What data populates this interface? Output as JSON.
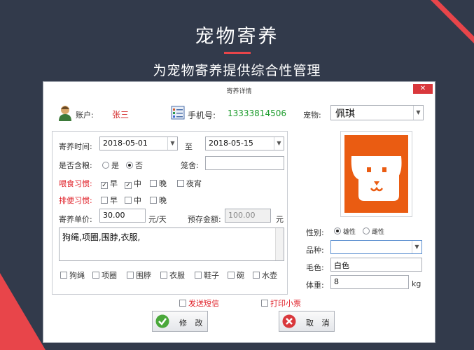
{
  "hero": {
    "title": "宠物寄养",
    "subtitle": "为宠物寄养提供综合性管理"
  },
  "dialog": {
    "title": "寄养详情",
    "close": "✕"
  },
  "account": {
    "label": "账户:",
    "value": "张三"
  },
  "phone": {
    "label": "手机号:",
    "value": "13333814506"
  },
  "pet": {
    "label": "宠物:",
    "value": "佩琪"
  },
  "period": {
    "label": "寄养时间:",
    "start": "2018-05-01",
    "to": "至",
    "end": "2018-05-15"
  },
  "food": {
    "label": "是否含粮:",
    "yes": "是",
    "no": "否",
    "selected": "否"
  },
  "cage": {
    "label": "笼舍:",
    "value": ""
  },
  "feeding": {
    "label": "喂食习惯:",
    "options": [
      {
        "label": "早",
        "checked": true
      },
      {
        "label": "中",
        "checked": true
      },
      {
        "label": "晚",
        "checked": false
      },
      {
        "label": "夜宵",
        "checked": false
      }
    ]
  },
  "excretion": {
    "label": "排便习惯:",
    "options": [
      {
        "label": "早",
        "checked": false
      },
      {
        "label": "中",
        "checked": false
      },
      {
        "label": "晚",
        "checked": false
      }
    ]
  },
  "price": {
    "label": "寄养单价:",
    "value": "30.00",
    "unit": "元/天"
  },
  "deposit": {
    "label": "预存金额:",
    "value": "100.00",
    "unit": "元"
  },
  "memo": "狗绳,项圈,围脖,衣服,",
  "items": [
    "狗绳",
    "项圈",
    "围脖",
    "衣服",
    "鞋子",
    "碗",
    "水壶"
  ],
  "gender": {
    "label": "性别:",
    "male": "雄性",
    "female": "雌性",
    "selected": "雄性"
  },
  "breed": {
    "label": "品种:",
    "value": ""
  },
  "coat": {
    "label": "毛色:",
    "value": "白色"
  },
  "weight": {
    "label": "体重:",
    "value": "8",
    "unit": "kg"
  },
  "sms": "发送短信",
  "receipt": "打印小票",
  "buttons": {
    "modify": "修 改",
    "cancel": "取 消"
  },
  "colors": {
    "accent": "#e8454a",
    "background": "#323a4b",
    "pet_image": "#ea5c12"
  }
}
